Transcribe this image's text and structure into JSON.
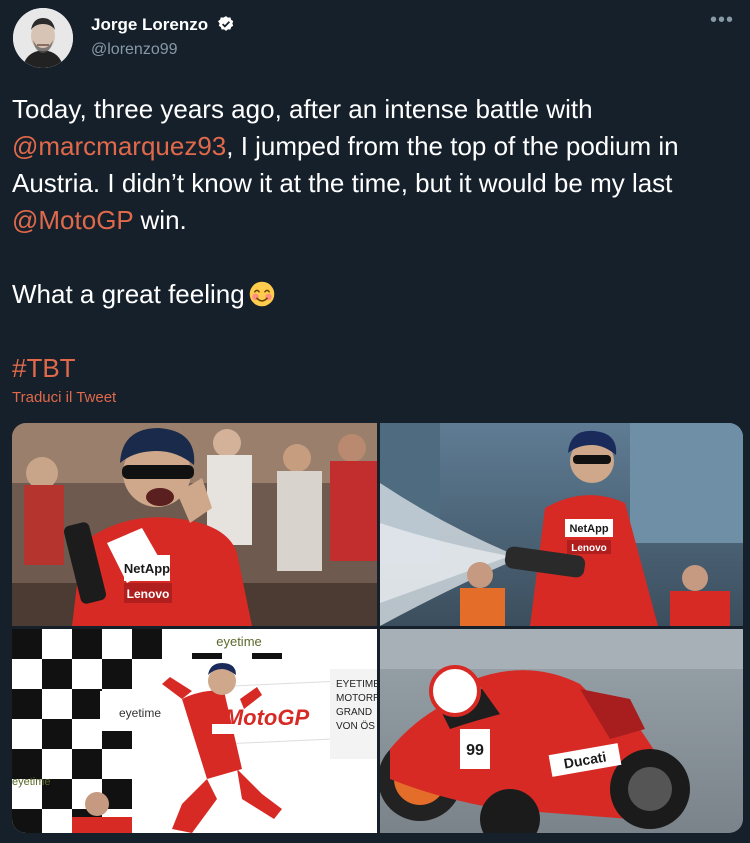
{
  "author": {
    "name": "Jorge Lorenzo",
    "handle": "@lorenzo99",
    "verified": true,
    "avatar_icon": "avatar-photo"
  },
  "tweet": {
    "line1_pre": "Today, three years ago, after an intense battle with",
    "mention1": "@marcmarquez93",
    "line2_post": ", I jumped from the top of the podium in Austria. I didn’t know it at the time, but it would be my last ",
    "mention2": "@MotoGP",
    "line_end": " win.",
    "line3": "What a great feeling",
    "emoji": "smiling-face-with-blush",
    "hashtag": "#TBT"
  },
  "translate_label": "Traduci il Tweet",
  "more_icon": "more-icon",
  "colors": {
    "background": "#15202b",
    "link": "#e0694b",
    "secondary_text": "#8899a6"
  },
  "photos": {
    "photo1_sign1": "NetApp",
    "photo1_sign2": "Lenovo",
    "photo2_sign1": "NetApp",
    "photo2_sign2": "Lenovo",
    "photo3_banner": "eyetime",
    "photo3_board_l1": "EYETIME",
    "photo3_board_l2": "MOTORR",
    "photo3_board_l3": "GRAND",
    "photo3_board_l4": "VON ÖS",
    "photo3_motogp": "MotoGP",
    "photo4_sign": "Ducati"
  }
}
